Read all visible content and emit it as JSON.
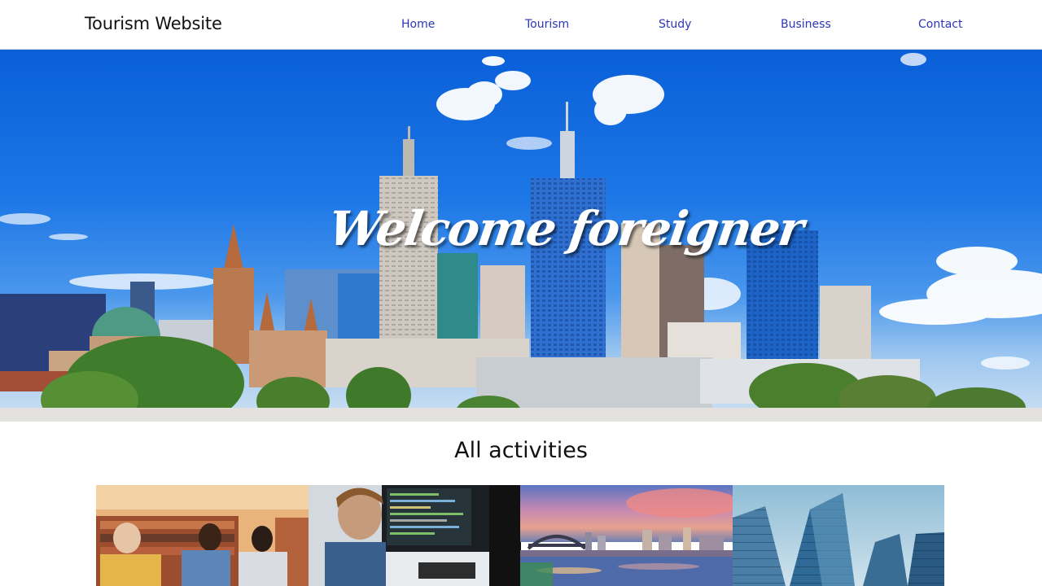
{
  "header": {
    "brand": "Tourism Website",
    "nav": [
      {
        "label": "Home"
      },
      {
        "label": "Tourism"
      },
      {
        "label": "Study"
      },
      {
        "label": "Business"
      },
      {
        "label": "Contact"
      }
    ]
  },
  "hero": {
    "title": "Welcome foreigner",
    "image": "city-skyline-photo"
  },
  "activities": {
    "title": "All activities",
    "cards": [
      {
        "image": "library-students-photo"
      },
      {
        "image": "programmer-monitor-photo"
      },
      {
        "image": "harbour-bridge-city-photo"
      },
      {
        "image": "glass-skyscrapers-photo"
      }
    ]
  },
  "colors": {
    "nav_link": "#2d36b8",
    "sky": "#1d77e6",
    "text": "#111111"
  }
}
